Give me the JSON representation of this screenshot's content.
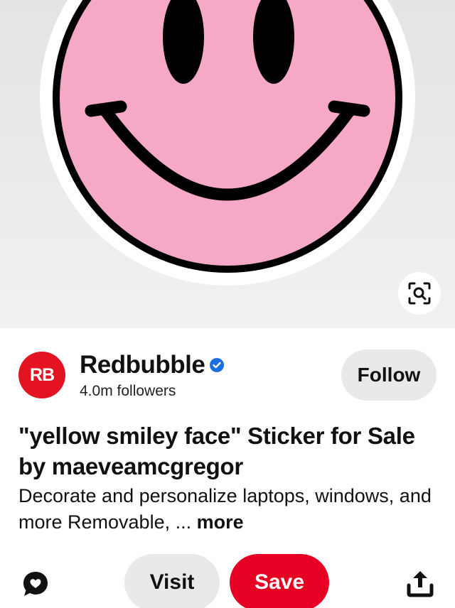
{
  "pin": {
    "image_description_icon": "pink-smiley-sticker",
    "visual_search_icon": "visual-search-icon"
  },
  "creator": {
    "avatar_text": "RB",
    "name": "Redbubble",
    "verified_icon": "verified-badge-icon",
    "followers": "4.0m followers",
    "follow_label": "Follow"
  },
  "content": {
    "title": "\"yellow smiley face\" Sticker for Sale by maeveamcgregor",
    "description": "Decorate and personalize laptops, windows, and more Removable, ...",
    "more_label": "more"
  },
  "actions": {
    "comment_icon": "comment-icon",
    "visit_label": "Visit",
    "save_label": "Save",
    "share_icon": "share-icon"
  },
  "colors": {
    "brand_red": "#e60023",
    "avatar_red": "#e41321",
    "smiley_pink": "#f5a9c7",
    "button_gray": "#e9e9e9",
    "verified_blue": "#1a6fe0"
  }
}
